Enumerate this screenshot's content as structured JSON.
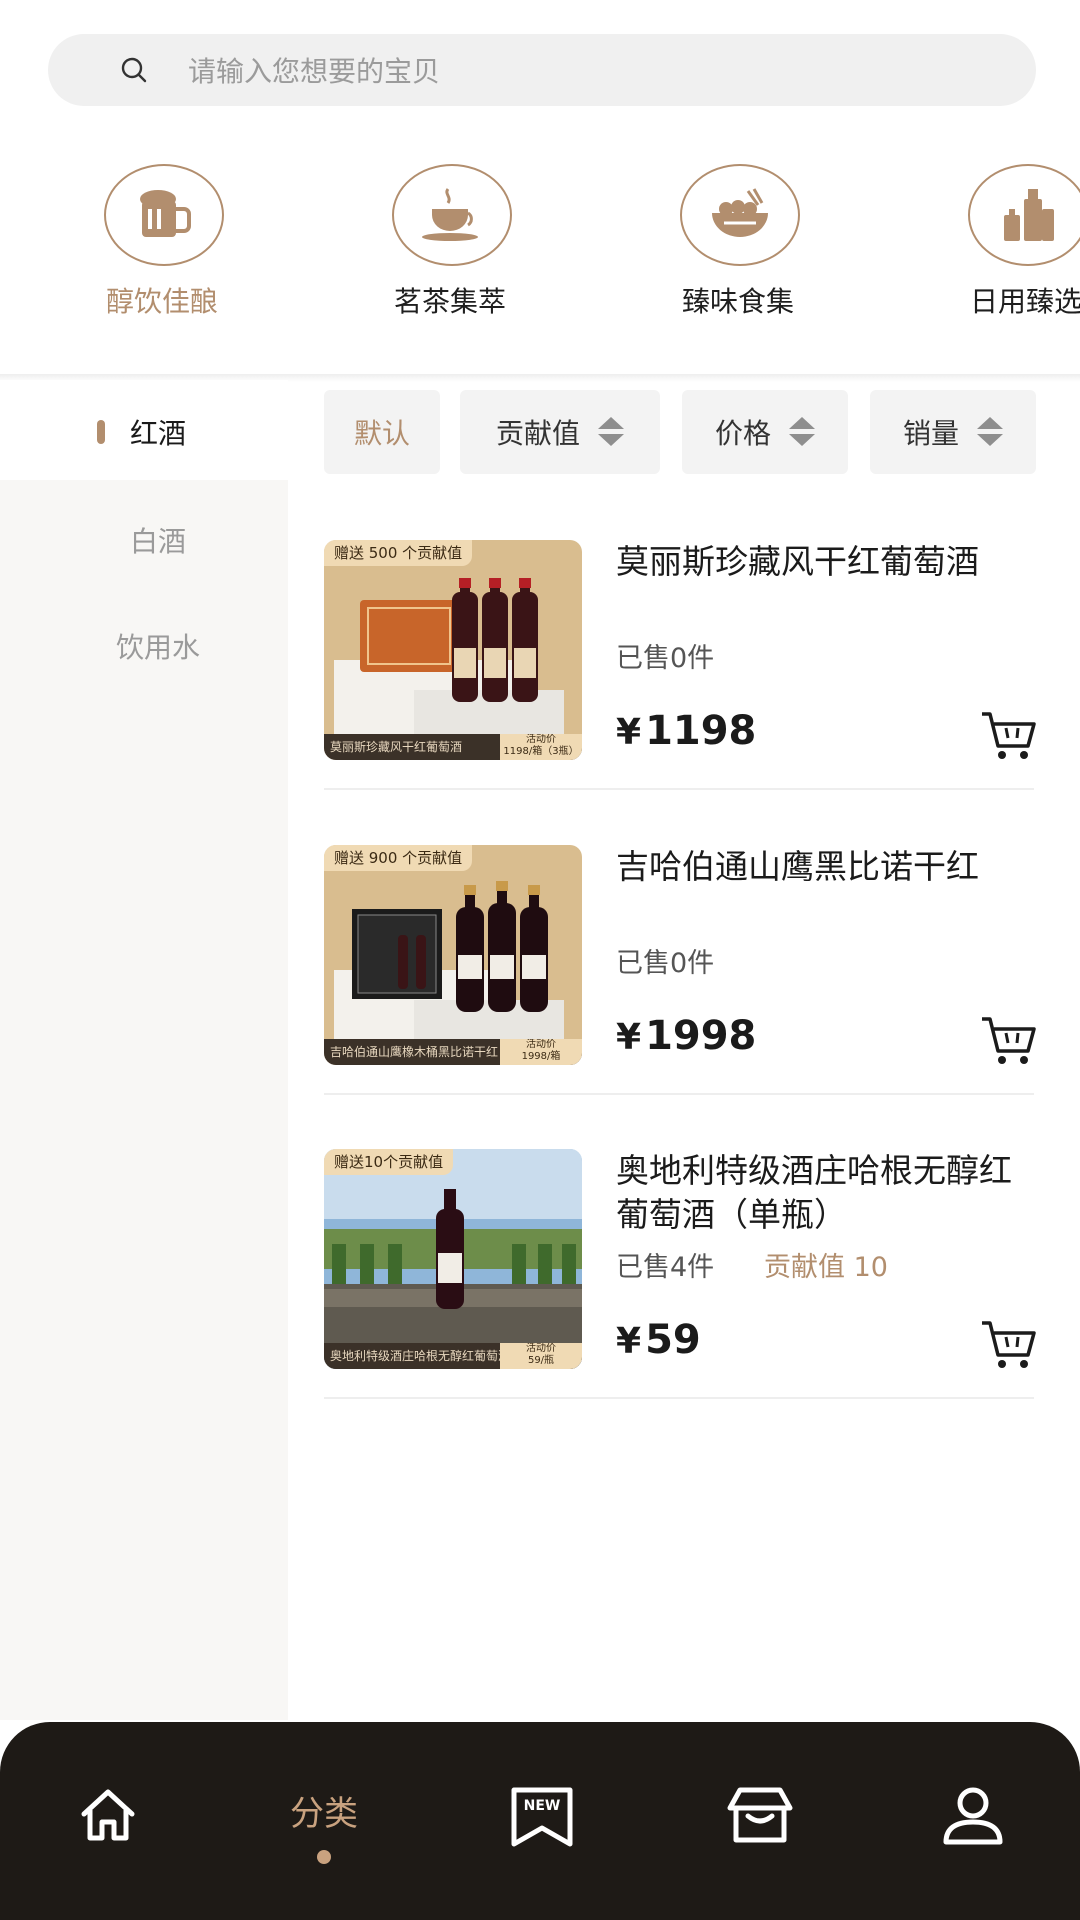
{
  "search": {
    "placeholder": "请输入您想要的宝贝"
  },
  "categories": [
    {
      "label": "醇饮佳酿",
      "icon": "beer-mug-icon",
      "active": true
    },
    {
      "label": "茗茶集萃",
      "icon": "teacup-icon"
    },
    {
      "label": "臻味食集",
      "icon": "food-bowl-icon"
    },
    {
      "label": "日用臻选",
      "icon": "bottles-icon"
    }
  ],
  "sidebar": {
    "items": [
      {
        "label": "红酒",
        "active": true
      },
      {
        "label": "白酒"
      },
      {
        "label": "饮用水"
      }
    ]
  },
  "sort": {
    "default": "默认",
    "contribution": "贡献值",
    "price": "价格",
    "sales": "销量"
  },
  "products": [
    {
      "tag": "赠送 500 个贡献值",
      "footer_name": "莫丽斯珍藏风干红葡萄酒",
      "footer_badge_top": "活动价",
      "footer_badge_bottom": "1198/箱（3瓶）",
      "title": "莫丽斯珍藏风干红葡萄酒",
      "sold": "已售0件",
      "contribution": "",
      "currency": "¥",
      "price": "1198"
    },
    {
      "tag": "赠送 900 个贡献值",
      "footer_name": "吉哈伯通山鹰橡木桶黑比诺干红",
      "footer_badge_top": "活动价",
      "footer_badge_bottom": "1998/箱",
      "title": "吉哈伯通山鹰黑比诺干红",
      "sold": "已售0件",
      "contribution": "",
      "currency": "¥",
      "price": "1998"
    },
    {
      "tag": "赠送10个贡献值",
      "footer_name": "奥地利特级酒庄哈根无醇红葡萄酒",
      "footer_badge_top": "活动价",
      "footer_badge_bottom": "59/瓶",
      "title": "奥地利特级酒庄哈根无醇红葡萄酒（单瓶）",
      "sold": "已售4件",
      "contribution": "贡献值 10",
      "currency": "¥",
      "price": "59"
    }
  ],
  "bottom_nav": {
    "items": [
      {
        "icon": "home-icon"
      },
      {
        "label": "分类",
        "active": true
      },
      {
        "icon": "new-bookmark-icon",
        "badge": "NEW"
      },
      {
        "icon": "store-icon"
      },
      {
        "icon": "user-icon"
      }
    ]
  },
  "colors": {
    "accent": "#b28e6e",
    "nav_bg": "#1e1a16",
    "sidebar_bg": "#f8f7f5"
  }
}
